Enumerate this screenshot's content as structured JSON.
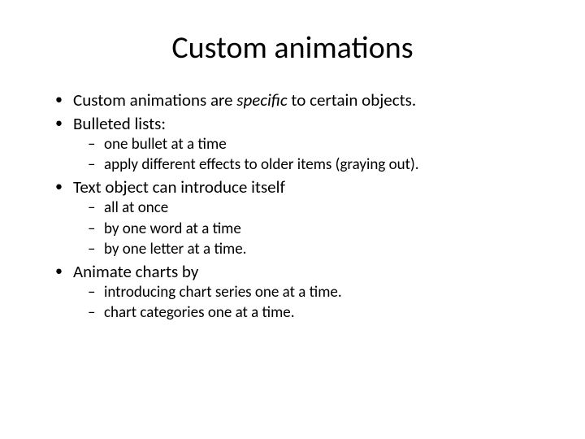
{
  "title": "Custom animations",
  "bullets": {
    "b1_pre": "Custom animations are ",
    "b1_em": "specific",
    "b1_post": " to certain objects.",
    "b2": "Bulleted lists:",
    "b2_sub": [
      "one bullet at a time",
      "apply different effects to older items (graying out)."
    ],
    "b3": "Text object can introduce itself",
    "b3_sub": [
      "all at once",
      "by one word at a time",
      "by one letter at a time."
    ],
    "b4": "Animate charts by",
    "b4_sub": [
      "introducing chart series one at a time.",
      "chart categories one at a time."
    ]
  }
}
